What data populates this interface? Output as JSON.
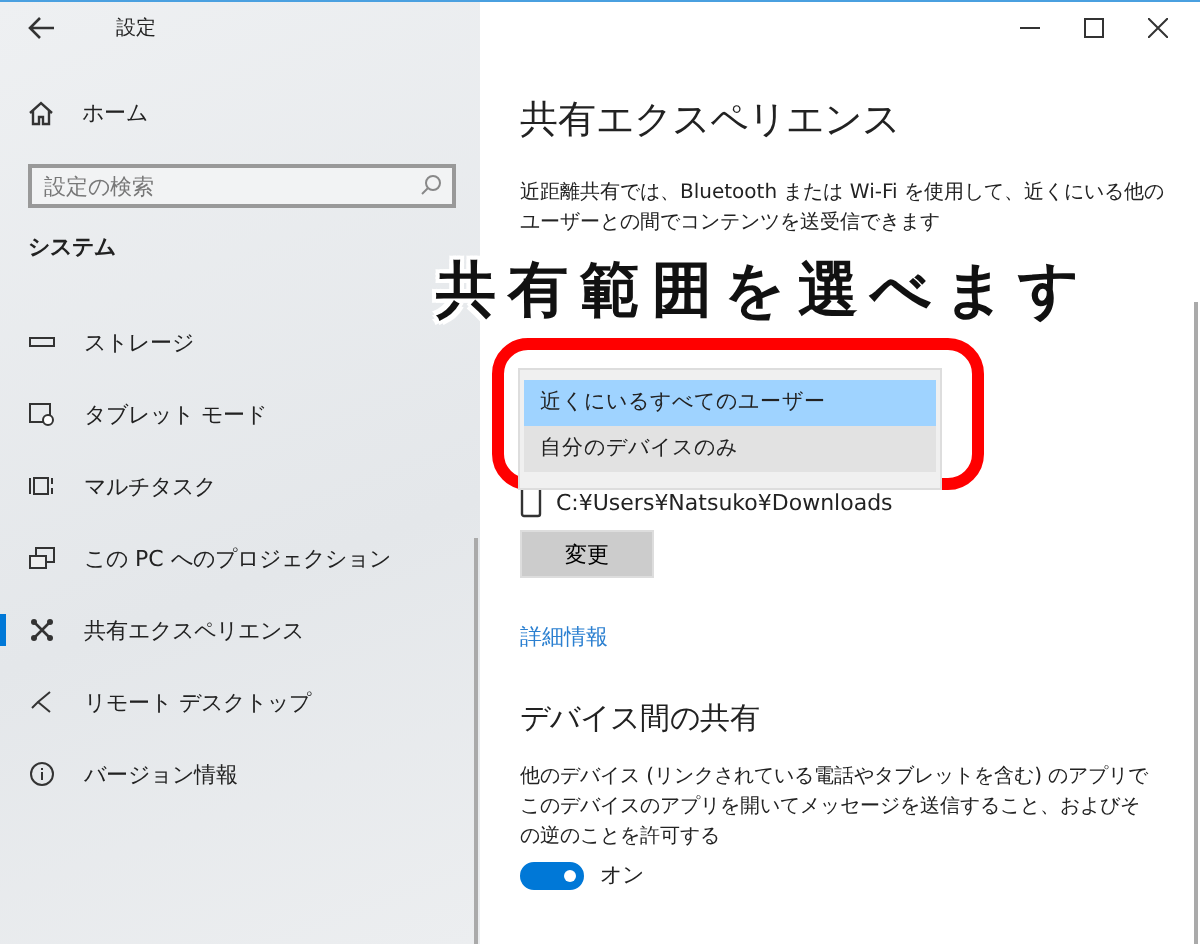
{
  "window": {
    "title": "設定"
  },
  "sidebar": {
    "home": "ホーム",
    "search": {
      "placeholder": "設定の検索"
    },
    "section": "システム",
    "items": [
      {
        "label": "ストレージ",
        "selected": false
      },
      {
        "label": "タブレット モード",
        "selected": false
      },
      {
        "label": "マルチタスク",
        "selected": false
      },
      {
        "label": "この PC へのプロジェクション",
        "selected": false
      },
      {
        "label": "共有エクスペリエンス",
        "selected": true
      },
      {
        "label": "リモート デスクトップ",
        "selected": false
      },
      {
        "label": "バージョン情報",
        "selected": false
      }
    ]
  },
  "content": {
    "title": "共有エクスペリエンス",
    "description": "近距離共有では、Bluetooth または Wi-Fi を使用して、近くにいる他のユーザーとの間でコンテンツを送受信できます",
    "dropdown_options": [
      {
        "label": "近くにいるすべてのユーザー",
        "selected": true
      },
      {
        "label": "自分のデバイスのみ",
        "selected": false
      }
    ],
    "folder_path": "C:¥Users¥Natsuko¥Downloads",
    "change_button": "変更",
    "more_info_link": "詳細情報",
    "section_title": "デバイス間の共有",
    "section_description": "他のデバイス (リンクされている電話やタブレットを含む) のアプリでこのデバイスのアプリを開いてメッセージを送信すること、およびその逆のことを許可する",
    "toggle": {
      "on": true,
      "label": "オン"
    }
  },
  "annotation": {
    "text": "共有範囲を選べます"
  }
}
